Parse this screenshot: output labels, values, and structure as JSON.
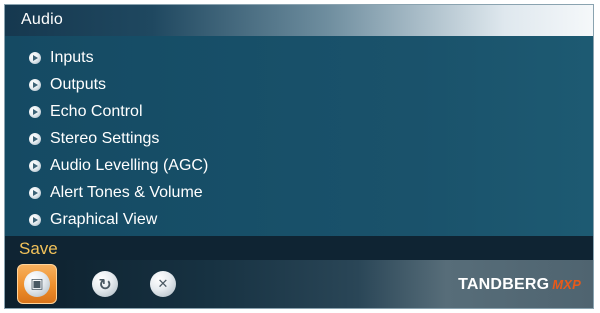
{
  "window": {
    "title": "Audio"
  },
  "menu": {
    "items": [
      {
        "label": "Inputs"
      },
      {
        "label": "Outputs"
      },
      {
        "label": "Echo Control"
      },
      {
        "label": "Stereo Settings"
      },
      {
        "label": "Audio Levelling (AGC)"
      },
      {
        "label": "Alert Tones & Volume"
      },
      {
        "label": "Graphical View"
      }
    ]
  },
  "status": {
    "text": "Save"
  },
  "toolbar": {
    "buttons": [
      {
        "name": "save",
        "icon": "floppy-disk-icon",
        "glyph": "▣"
      },
      {
        "name": "refresh",
        "icon": "refresh-icon",
        "glyph": "↻"
      },
      {
        "name": "cancel",
        "icon": "close-icon",
        "glyph": "✕"
      }
    ]
  },
  "brand": {
    "name": "TANDBERG",
    "model": "MXP"
  },
  "colors": {
    "panel_bg": "#154a63",
    "status_text": "#f2c25a",
    "active_button": "#ee8f2c",
    "brand_model": "#e85a1a"
  }
}
